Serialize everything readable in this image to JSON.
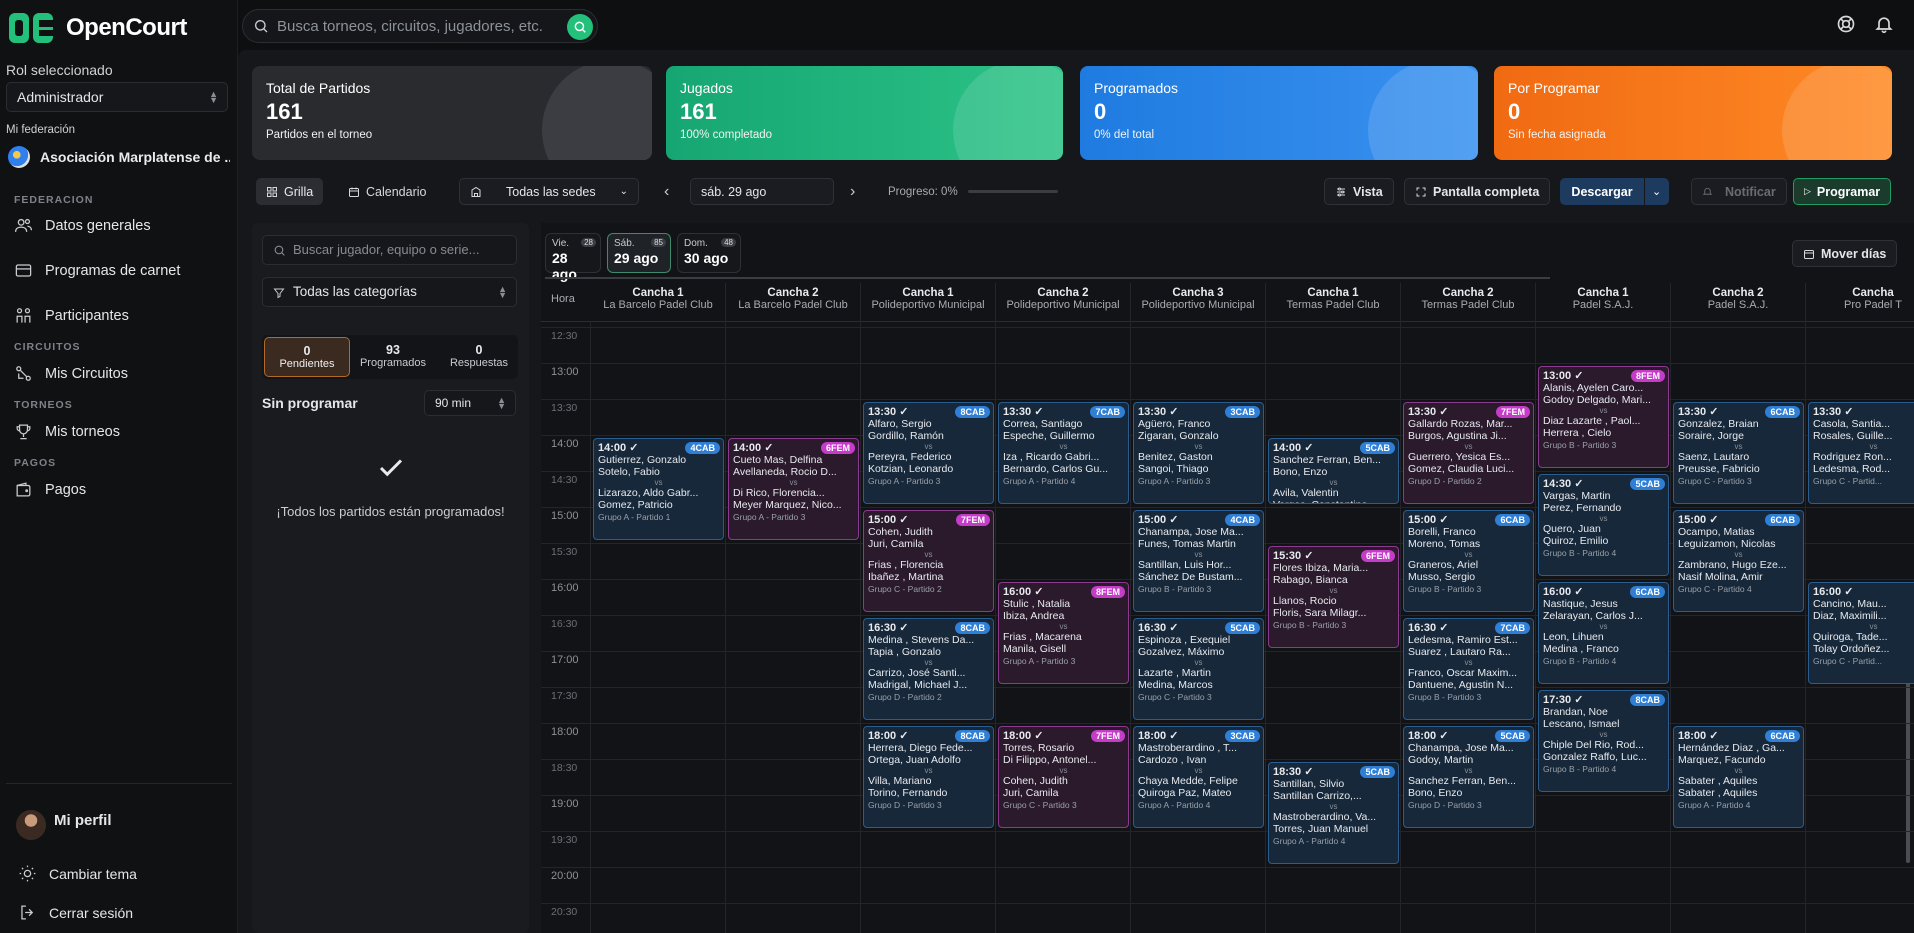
{
  "app": {
    "name": "OpenCourt"
  },
  "sidebar": {
    "role_label": "Rol seleccionado",
    "role_value": "Administrador",
    "federation_label": "Mi federación",
    "federation_value": "Asociación Marplatense de ...",
    "sections": {
      "federacion": "FEDERACION",
      "circuitos": "CIRCUITOS",
      "torneos": "TORNEOS",
      "pagos": "PAGOS"
    },
    "items": {
      "datos": "Datos generales",
      "carnet": "Programas de carnet",
      "participantes": "Participantes",
      "circuitos": "Mis Circuitos",
      "torneos": "Mis torneos",
      "pagos": "Pagos"
    },
    "profile": "Mi perfil",
    "theme": "Cambiar tema",
    "logout": "Cerrar sesión"
  },
  "search": {
    "placeholder": "Busca torneos, circuitos, jugadores, etc."
  },
  "stats": [
    {
      "title": "Total de Partidos",
      "value": "161",
      "sub": "Partidos en el torneo"
    },
    {
      "title": "Jugados",
      "value": "161",
      "sub": "100% completado"
    },
    {
      "title": "Programados",
      "value": "0",
      "sub": "0% del total"
    },
    {
      "title": "Por Programar",
      "value": "0",
      "sub": "Sin fecha asignada"
    }
  ],
  "toolbar": {
    "grid": "Grilla",
    "calendar": "Calendario",
    "venues": "Todas las sedes",
    "date": "sáb. 29 ago",
    "progress": "Progreso: 0%",
    "view": "Vista",
    "fullscreen": "Pantalla completa",
    "download": "Descargar",
    "notify": "Notificar",
    "schedule": "Programar",
    "move_days": "Mover días"
  },
  "panel": {
    "search_placeholder": "Buscar jugador, equipo o serie...",
    "categories": "Todas las categorías",
    "tabs": [
      {
        "count": "0",
        "label": "Pendientes"
      },
      {
        "count": "93",
        "label": "Programados"
      },
      {
        "count": "0",
        "label": "Respuestas"
      }
    ],
    "unscheduled": "Sin programar",
    "duration": "90 min",
    "done_message": "¡Todos los partidos están programados!"
  },
  "days": [
    {
      "dow": "Vie.",
      "date": "28 ago",
      "count": "28"
    },
    {
      "dow": "Sáb.",
      "date": "29 ago",
      "count": "85"
    },
    {
      "dow": "Dom.",
      "date": "30 ago",
      "count": "48"
    }
  ],
  "hour_label": "Hora",
  "columns": [
    {
      "court": "Cancha 1",
      "venue": "La Barcelo Padel Club"
    },
    {
      "court": "Cancha 2",
      "venue": "La Barcelo Padel Club"
    },
    {
      "court": "Cancha 1",
      "venue": "Polideportivo Municipal"
    },
    {
      "court": "Cancha 2",
      "venue": "Polideportivo Municipal"
    },
    {
      "court": "Cancha 3",
      "venue": "Polideportivo Municipal"
    },
    {
      "court": "Cancha 1",
      "venue": "Termas Padel Club"
    },
    {
      "court": "Cancha 2",
      "venue": "Termas Padel Club"
    },
    {
      "court": "Cancha 1",
      "venue": "Padel S.A.J."
    },
    {
      "court": "Cancha 2",
      "venue": "Padel S.A.J."
    },
    {
      "court": "Cancha",
      "venue": "Pro Padel T"
    }
  ],
  "times": [
    "12:30",
    "13:00",
    "13:30",
    "14:00",
    "14:30",
    "15:00",
    "15:30",
    "16:00",
    "16:30",
    "17:00",
    "17:30",
    "18:00",
    "18:30",
    "19:00",
    "19:30",
    "20:00",
    "20:30"
  ],
  "matches": [
    {
      "col": 0,
      "slot": 3,
      "span": 3,
      "color": "blue",
      "time": "14:00",
      "badge": "4CAB",
      "a": "Gutierrez, Gonzalo",
      "a2": "Sotelo, Fabio",
      "b": "Lizarazo, Aldo Gabr...",
      "b2": "Gomez, Patricio",
      "group": "Grupo A - Partido 1"
    },
    {
      "col": 1,
      "slot": 3,
      "span": 3,
      "color": "pink",
      "time": "14:00",
      "badge": "6FEM",
      "a": "Cueto Mas, Delfina",
      "a2": "Avellaneda, Rocio D...",
      "b": "Di Rico, Florencia...",
      "b2": "Meyer Marquez, Nico...",
      "group": "Grupo A - Partido 3"
    },
    {
      "col": 2,
      "slot": 2,
      "span": 3,
      "color": "blue",
      "time": "13:30",
      "badge": "8CAB",
      "a": "Alfaro, Sergio",
      "a2": "Gordillo, Ramón",
      "b": "Pereyra, Federico",
      "b2": "Kotzian, Leonardo",
      "group": "Grupo A - Partido 3"
    },
    {
      "col": 2,
      "slot": 5,
      "span": 3,
      "color": "pink",
      "time": "15:00",
      "badge": "7FEM",
      "a": "Cohen, Judith",
      "a2": "Juri, Camila",
      "b": "Frias , Florencia",
      "b2": "Ibañez , Martina",
      "group": "Grupo C - Partido 2"
    },
    {
      "col": 2,
      "slot": 8,
      "span": 3,
      "color": "blue",
      "time": "16:30",
      "badge": "8CAB",
      "a": "Medina , Stevens Da...",
      "a2": "Tapia , Gonzalo",
      "b": "Carrizo, José Santi...",
      "b2": "Madrigal, Michael J...",
      "group": "Grupo D - Partido 2"
    },
    {
      "col": 2,
      "slot": 11,
      "span": 3,
      "color": "blue",
      "time": "18:00",
      "badge": "8CAB",
      "a": "Herrera, Diego Fede...",
      "a2": "Ortega, Juan Adolfo",
      "b": "Villa, Mariano",
      "b2": "Torino, Fernando",
      "group": "Grupo D - Partido 3"
    },
    {
      "col": 3,
      "slot": 2,
      "span": 3,
      "color": "blue",
      "time": "13:30",
      "badge": "7CAB",
      "a": "Correa, Santiago",
      "a2": "Espeche, Guillermo",
      "b": "Iza , Ricardo Gabri...",
      "b2": "Bernardo, Carlos Gu...",
      "group": "Grupo A - Partido 4"
    },
    {
      "col": 3,
      "slot": 7,
      "span": 3,
      "color": "pink",
      "time": "16:00",
      "badge": "8FEM",
      "a": "Stulic , Natalia",
      "a2": "Ibiza, Andrea",
      "b": "Frias , Macarena",
      "b2": "Manila, Gisell",
      "group": "Grupo A - Partido 3"
    },
    {
      "col": 3,
      "slot": 11,
      "span": 3,
      "color": "pink",
      "time": "18:00",
      "badge": "7FEM",
      "a": "Torres, Rosario",
      "a2": "Di Filippo, Antonel...",
      "b": "Cohen, Judith",
      "b2": "Juri, Camila",
      "group": "Grupo C - Partido 3"
    },
    {
      "col": 4,
      "slot": 2,
      "span": 3,
      "color": "blue",
      "time": "13:30",
      "badge": "3CAB",
      "a": "Agüero, Franco",
      "a2": "Zigaran, Gonzalo",
      "b": "Benitez, Gaston",
      "b2": "Sangoi, Thiago",
      "group": "Grupo A - Partido 3"
    },
    {
      "col": 4,
      "slot": 5,
      "span": 3,
      "color": "blue",
      "time": "15:00",
      "badge": "4CAB",
      "a": "Chanampa, Jose Ma...",
      "a2": "Funes, Tomas Martin",
      "b": "Santillan, Luis Hor...",
      "b2": "Sánchez De Bustam...",
      "group": "Grupo B - Partido 3"
    },
    {
      "col": 4,
      "slot": 8,
      "span": 3,
      "color": "blue",
      "time": "16:30",
      "badge": "5CAB",
      "a": "Espinoza , Exequiel",
      "a2": "Gozalvez, Máximo",
      "b": "Lazarte , Martin",
      "b2": "Medina, Marcos",
      "group": "Grupo C - Partido 3"
    },
    {
      "col": 4,
      "slot": 11,
      "span": 3,
      "color": "blue",
      "time": "18:00",
      "badge": "3CAB",
      "a": "Mastroberardino , T...",
      "a2": "Cardozo , Ivan",
      "b": "Chaya Medde, Felipe",
      "b2": "Quiroga Paz, Mateo",
      "group": "Grupo A - Partido 4"
    },
    {
      "col": 5,
      "slot": 3,
      "span": 2,
      "color": "blue",
      "time": "14:00",
      "badge": "5CAB",
      "a": "Sanchez Ferran, Ben...",
      "a2": "Bono, Enzo",
      "b": "Avila, Valentin",
      "b2": "Vargas, Constantino",
      "group": "Grupo D - Partido 2"
    },
    {
      "col": 5,
      "slot": 6,
      "span": 3,
      "color": "pink",
      "time": "15:30",
      "badge": "6FEM",
      "a": "Flores Ibiza, Maria...",
      "a2": "Rabago, Bianca",
      "b": "Llanos, Rocio",
      "b2": "Floris, Sara Milagr...",
      "group": "Grupo B - Partido 3"
    },
    {
      "col": 5,
      "slot": 12,
      "span": 3,
      "color": "blue",
      "time": "18:30",
      "badge": "5CAB",
      "a": "Santillan, Silvio",
      "a2": "Santillan Carrizo,...",
      "b": "Mastroberardino, Va...",
      "b2": "Torres, Juan Manuel",
      "group": "Grupo A - Partido 4"
    },
    {
      "col": 6,
      "slot": 2,
      "span": 3,
      "color": "pink",
      "time": "13:30",
      "badge": "7FEM",
      "a": "Gallardo Rozas, Mar...",
      "a2": "Burgos, Agustina Ji...",
      "b": "Guerrero, Yesica Es...",
      "b2": "Gomez, Claudia Luci...",
      "group": "Grupo D - Partido 2"
    },
    {
      "col": 6,
      "slot": 5,
      "span": 3,
      "color": "blue",
      "time": "15:00",
      "badge": "6CAB",
      "a": "Borelli, Franco",
      "a2": "Moreno, Tomas",
      "b": "Graneros, Ariel",
      "b2": "Musso, Sergio",
      "group": "Grupo B - Partido 3"
    },
    {
      "col": 6,
      "slot": 8,
      "span": 3,
      "color": "blue",
      "time": "16:30",
      "badge": "7CAB",
      "a": "Ledesma, Ramiro Est...",
      "a2": "Suarez , Lautaro Ra...",
      "b": "Franco, Oscar Maxim...",
      "b2": "Dantuene, Agustin N...",
      "group": "Grupo B - Partido 3"
    },
    {
      "col": 6,
      "slot": 11,
      "span": 3,
      "color": "blue",
      "time": "18:00",
      "badge": "5CAB",
      "a": "Chanampa, Jose Ma...",
      "a2": "Godoy, Martin",
      "b": "Sanchez Ferran, Ben...",
      "b2": "Bono, Enzo",
      "group": "Grupo D - Partido 3"
    },
    {
      "col": 7,
      "slot": 1,
      "span": 3,
      "color": "pink",
      "time": "13:00",
      "badge": "8FEM",
      "a": "Alanis, Ayelen Caro...",
      "a2": "Godoy Delgado, Mari...",
      "b": "Diaz Lazarte , Paol...",
      "b2": "Herrera , Cielo",
      "group": "Grupo B - Partido 3"
    },
    {
      "col": 7,
      "slot": 4,
      "span": 3,
      "color": "blue",
      "time": "14:30",
      "badge": "5CAB",
      "a": "Vargas, Martin",
      "a2": "Perez, Fernando",
      "b": "Quero, Juan",
      "b2": "Quiroz, Emilio",
      "group": "Grupo B - Partido 4"
    },
    {
      "col": 7,
      "slot": 7,
      "span": 3,
      "color": "blue",
      "time": "16:00",
      "badge": "6CAB",
      "a": "Nastique, Jesus",
      "a2": "Zelarayan, Carlos J...",
      "b": "Leon, Lihuen",
      "b2": "Medina , Franco",
      "group": "Grupo B - Partido 4"
    },
    {
      "col": 7,
      "slot": 10,
      "span": 3,
      "color": "blue",
      "time": "17:30",
      "badge": "8CAB",
      "a": "Brandan, Noe",
      "a2": "Lescano, Ismael",
      "b": "Chiple Del Rio, Rod...",
      "b2": "Gonzalez Raffo, Luc...",
      "group": "Grupo B - Partido 4"
    },
    {
      "col": 8,
      "slot": 2,
      "span": 3,
      "color": "blue",
      "time": "13:30",
      "badge": "6CAB",
      "a": "Gonzalez, Braian",
      "a2": "Soraire, Jorge",
      "b": "Saenz, Lautaro",
      "b2": "Preusse, Fabricio",
      "group": "Grupo C - Partido 3"
    },
    {
      "col": 8,
      "slot": 5,
      "span": 3,
      "color": "blue",
      "time": "15:00",
      "badge": "6CAB",
      "a": "Ocampo, Matias",
      "a2": "Leguizamon, Nicolas",
      "b": "Zambrano, Hugo Eze...",
      "b2": "Nasif Molina, Amir",
      "group": "Grupo C - Partido 4"
    },
    {
      "col": 8,
      "slot": 11,
      "span": 3,
      "color": "blue",
      "time": "18:00",
      "badge": "6CAB",
      "a": "Hernández Diaz , Ga...",
      "a2": "Marquez, Facundo",
      "b": "Sabater , Aquiles",
      "b2": "Sabater , Aquiles",
      "group": "Grupo A - Partido 4"
    },
    {
      "col": 9,
      "slot": 2,
      "span": 3,
      "color": "blue",
      "time": "13:30",
      "badge": "",
      "a": "Casola, Santia...",
      "a2": "Rosales, Guille...",
      "b": "Rodriguez Ron...",
      "b2": "Ledesma, Rod...",
      "group": "Grupo C - Partid..."
    },
    {
      "col": 9,
      "slot": 7,
      "span": 3,
      "color": "blue",
      "time": "16:00",
      "badge": "",
      "a": "Cancino, Mau...",
      "a2": "Diaz, Maximili...",
      "b": "Quiroga, Tade...",
      "b2": "Tolay Ordoñez...",
      "group": "Grupo C - Partid..."
    }
  ]
}
